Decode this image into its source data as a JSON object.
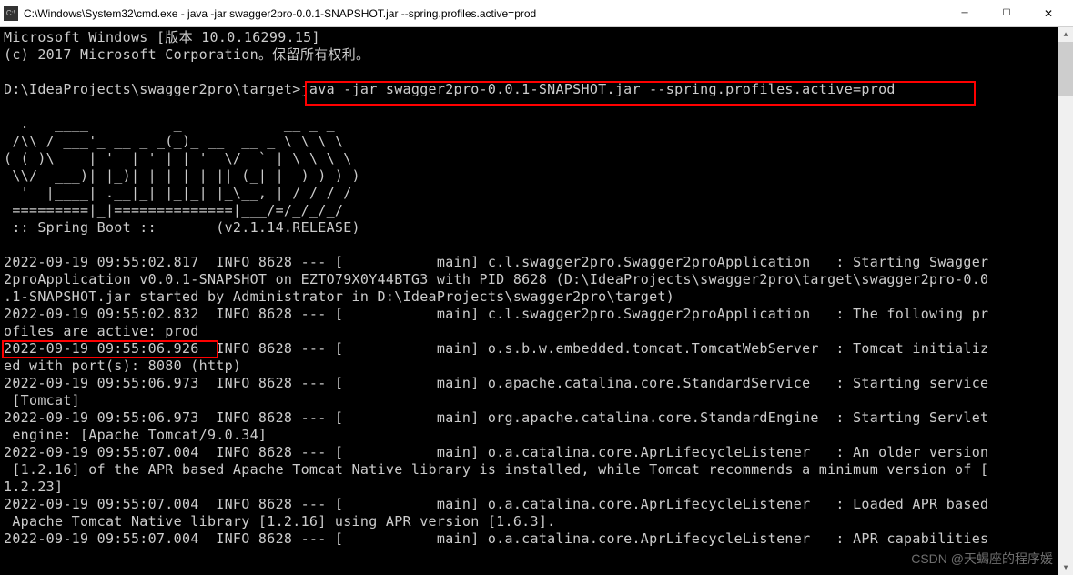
{
  "titlebar": {
    "icon_label": "C:\\",
    "title": "C:\\Windows\\System32\\cmd.exe - java  -jar swagger2pro-0.0.1-SNAPSHOT.jar --spring.profiles.active=prod"
  },
  "console": {
    "header_line1": "Microsoft Windows [版本 10.0.16299.15]",
    "header_line2": "(c) 2017 Microsoft Corporation。保留所有权利。",
    "prompt_path": "D:\\IdeaProjects\\swagger2pro\\target>",
    "command": "java -jar swagger2pro-0.0.1-SNAPSHOT.jar --spring.profiles.active=prod",
    "banner": [
      "  .   ____          _            __ _ _",
      " /\\\\ / ___'_ __ _ _(_)_ __  __ _ \\ \\ \\ \\",
      "( ( )\\___ | '_ | '_| | '_ \\/ _` | \\ \\ \\ \\",
      " \\\\/  ___)| |_)| | | | | || (_| |  ) ) ) )",
      "  '  |____| .__|_| |_|_| |_\\__, | / / / /",
      " =========|_|==============|___/=/_/_/_/"
    ],
    "boot_label": " :: Spring Boot ::       (v2.1.14.RELEASE)",
    "log_lines": [
      "2022-09-19 09:55:02.817  INFO 8628 --- [           main] c.l.swagger2pro.Swagger2proApplication   : Starting Swagger",
      "2proApplication v0.0.1-SNAPSHOT on EZTO79X0Y44BTG3 with PID 8628 (D:\\IdeaProjects\\swagger2pro\\target\\swagger2pro-0.0",
      ".1-SNAPSHOT.jar started by Administrator in D:\\IdeaProjects\\swagger2pro\\target)",
      "2022-09-19 09:55:02.832  INFO 8628 --- [           main] c.l.swagger2pro.Swagger2proApplication   : The following pr",
      "ofiles are active: prod",
      "2022-09-19 09:55:06.926  INFO 8628 --- [           main] o.s.b.w.embedded.tomcat.TomcatWebServer  : Tomcat initializ",
      "ed with port(s): 8080 (http)",
      "2022-09-19 09:55:06.973  INFO 8628 --- [           main] o.apache.catalina.core.StandardService   : Starting service",
      " [Tomcat]",
      "2022-09-19 09:55:06.973  INFO 8628 --- [           main] org.apache.catalina.core.StandardEngine  : Starting Servlet",
      " engine: [Apache Tomcat/9.0.34]",
      "2022-09-19 09:55:07.004  INFO 8628 --- [           main] o.a.catalina.core.AprLifecycleListener   : An older version",
      " [1.2.16] of the APR based Apache Tomcat Native library is installed, while Tomcat recommends a minimum version of [",
      "1.2.23]",
      "2022-09-19 09:55:07.004  INFO 8628 --- [           main] o.a.catalina.core.AprLifecycleListener   : Loaded APR based",
      " Apache Tomcat Native library [1.2.16] using APR version [1.6.3].",
      "2022-09-19 09:55:07.004  INFO 8628 --- [           main] o.a.catalina.core.AprLifecycleListener   : APR capabilities"
    ]
  },
  "watermark": "CSDN @天蝎座的程序媛"
}
